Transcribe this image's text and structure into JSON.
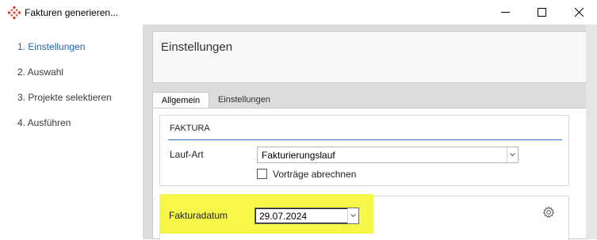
{
  "window": {
    "title": "Fakturen generieren...",
    "controls": {
      "minimize": "minimize-icon",
      "maximize": "maximize-icon",
      "close": "close-icon"
    },
    "app_icon": "app-logo-icon"
  },
  "sidebar": {
    "items": [
      {
        "label": "1. Einstellungen",
        "active": true
      },
      {
        "label": "2. Auswahl",
        "active": false
      },
      {
        "label": "3. Projekte selektieren",
        "active": false
      },
      {
        "label": "4. Ausführen",
        "active": false
      }
    ]
  },
  "main": {
    "header_title": "Einstellungen",
    "tabs": [
      {
        "label": "Allgemein",
        "active": true
      },
      {
        "label": "Einstellungen",
        "active": false
      }
    ],
    "faktura_group": {
      "title": "FAKTURA",
      "lauf_art_label": "Lauf-Art",
      "lauf_art_value": "Fakturierungslauf",
      "vortraege_label": "Vorträge abrechnen",
      "vortraege_checked": false
    },
    "date_group": {
      "label": "Fakturadatum",
      "value": "29.07.2024",
      "settings_icon": "gear-icon"
    }
  },
  "colors": {
    "accent": "#1e66b4",
    "highlight": "#f7f74a",
    "group_divider": "#2b78c8",
    "panel_bg": "#dcdcdc"
  }
}
